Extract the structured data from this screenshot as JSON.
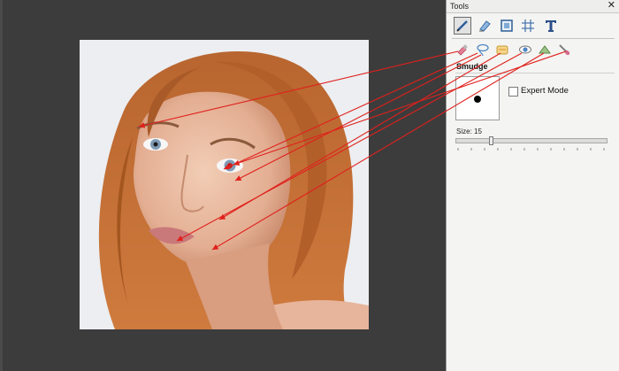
{
  "panel": {
    "title": "Tools",
    "close_glyph": "✕",
    "section_title": "Smudge",
    "expert_mode_label": "Expert Mode",
    "expert_mode_checked": false,
    "size_label": "Size: 15",
    "size_value": 15
  },
  "tools": {
    "row1": [
      "brush-tool-icon",
      "eraser-tool-icon",
      "crop-tool-icon",
      "grid-tool-icon",
      "text-tool-icon"
    ],
    "row2": [
      "smudge-tool-icon",
      "lasso-tool-icon",
      "blend-tool-icon",
      "red-eye-tool-icon",
      "sharpen-tool-icon",
      "dodge-tool-icon"
    ]
  },
  "colors": {
    "canvas_bg": "#3c3c3c",
    "panel_bg": "#f4f4f2",
    "arrow": "#e0201c"
  }
}
